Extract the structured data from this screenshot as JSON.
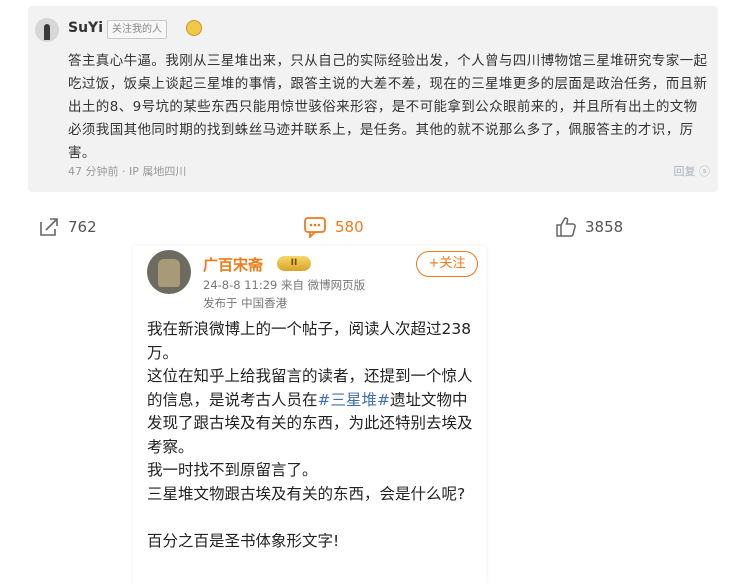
{
  "comment": {
    "username": "SuYi",
    "follow_tag": "关注我的人",
    "body": "答主真心牛逼。我刚从三星堆出来，只从自己的实际经验出发，个人曾与四川博物馆三星堆研究专家一起吃过饭，饭桌上谈起三星堆的事情，跟答主说的大差不差，现在的三星堆更多的层面是政治任务，而且新出土的8、9号坑的某些东西只能用惊世骇俗来形容，是不可能拿到公众眼前来的，并且所有出土的文物必须我国其他同时期的找到蛛丝马迹并联系上，是任务。其他的就不说那么多了，佩服答主的才识，厉害。",
    "time": "47 分钟前",
    "ip": "IP 属地四川",
    "watermark": "回复  ⓢ"
  },
  "actions": {
    "share_count": "762",
    "comment_count": "580",
    "like_count": "3858"
  },
  "weibo": {
    "author": "广百宋斋",
    "vip_badge": "II",
    "follow_label": "+关注",
    "meta_line1": "24-8-8 11:29  来自 微博网页版",
    "meta_line2": "发布于 中国香港",
    "para1": "我在新浪微博上的一个帖子，阅读人次超过238万。",
    "para2_before": "这位在知乎上给我留言的读者，还提到一个惊人的信息，是说考古人员在",
    "para2_hashtag": "#三星堆#",
    "para2_after": "遗址文物中发现了跟古埃及有关的东西，为此还特别去埃及考察。",
    "para3": "我一时找不到原留言了。",
    "para4": "三星堆文物跟古埃及有关的东西，会是什么呢?",
    "para5": "百分之百是圣书体象形文字!"
  },
  "colors": {
    "accent_orange": "#f07a1c",
    "hashtag_blue": "#3f6fb4"
  }
}
